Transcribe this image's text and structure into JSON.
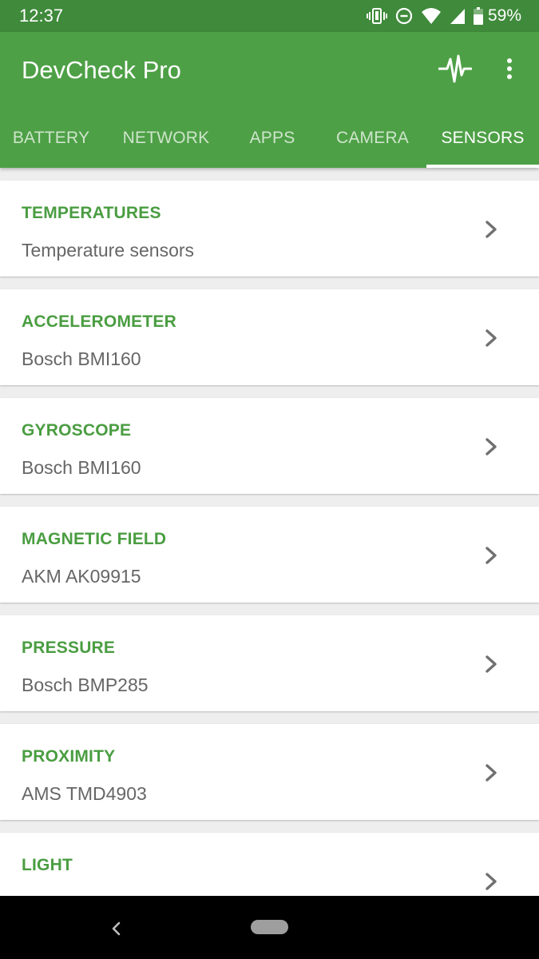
{
  "status_bar": {
    "time": "12:37",
    "battery_percent": "59%",
    "icons": [
      "vibrate-icon",
      "do-not-disturb-icon",
      "wifi-icon",
      "cell-signal-icon",
      "battery-icon"
    ]
  },
  "app_bar": {
    "title": "DevCheck Pro",
    "actions": [
      "pulse-icon",
      "overflow-menu-icon"
    ]
  },
  "tabs": [
    {
      "label": "BATTERY",
      "active": false
    },
    {
      "label": "NETWORK",
      "active": false
    },
    {
      "label": "APPS",
      "active": false
    },
    {
      "label": "CAMERA",
      "active": false
    },
    {
      "label": "SENSORS",
      "active": true
    }
  ],
  "sensors": [
    {
      "title": "TEMPERATURES",
      "subtitle": "Temperature sensors"
    },
    {
      "title": "ACCELEROMETER",
      "subtitle": "Bosch BMI160"
    },
    {
      "title": "GYROSCOPE",
      "subtitle": "Bosch BMI160"
    },
    {
      "title": "MAGNETIC FIELD",
      "subtitle": "AKM AK09915"
    },
    {
      "title": "PRESSURE",
      "subtitle": "Bosch BMP285"
    },
    {
      "title": "PROXIMITY",
      "subtitle": "AMS TMD4903"
    },
    {
      "title": "LIGHT",
      "subtitle": ""
    }
  ],
  "colors": {
    "status_bar": "#3f8a3b",
    "app_bar": "#4ea046",
    "accent_text": "#4a9d41",
    "background": "#eeeeee"
  }
}
